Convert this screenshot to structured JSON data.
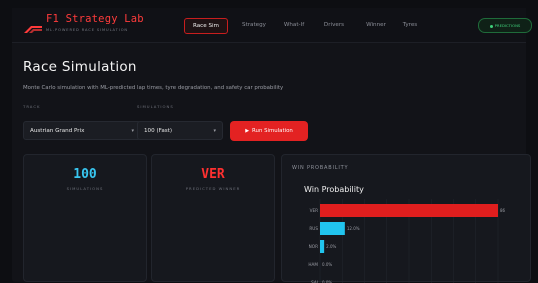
{
  "nav": {
    "brand": "F1 Strategy Lab",
    "brand_sub": "ML-POWERED RACE SIMULATION",
    "tabs": [
      {
        "label": "Race Sim",
        "active": true
      },
      {
        "label": "Strategy",
        "active": false
      },
      {
        "label": "What-If",
        "active": false
      },
      {
        "label": "Drivers",
        "active": false
      },
      {
        "label": "Winner",
        "active": false
      },
      {
        "label": "Tyres",
        "active": false
      }
    ],
    "status": "PREDICTIONS"
  },
  "header": {
    "title": "Race Simulation",
    "subtitle": "Monte Carlo simulation with ML-predicted lap times, tyre degradation, and safety car probability"
  },
  "controls": {
    "track_label": "TRACK",
    "track_value": "Austrian Grand Prix",
    "sims_label": "SIMULATIONS",
    "sims_value": "100 (Fast)",
    "run_label": "Run Simulation"
  },
  "stats": [
    {
      "value": "100",
      "label": "SIMULATIONS",
      "color": "#38c6f0"
    },
    {
      "value": "VER",
      "label": "PREDICTED WINNER",
      "color": "#ff3030"
    }
  ],
  "win_panel": {
    "header": "WIN PROBABILITY"
  },
  "colors": {
    "accent": "#e32222",
    "secondary": "#21c4ee"
  },
  "chart_data": {
    "type": "bar",
    "orientation": "horizontal",
    "title": "Win Probability",
    "categories": [
      "VER",
      "RUS",
      "NOR",
      "HAM",
      "SAI"
    ],
    "values": [
      86,
      12.0,
      2.0,
      0.0,
      0.0
    ],
    "value_labels": [
      "86",
      "12.0%",
      "2.0%",
      "0.0%",
      "0.0%"
    ],
    "bar_colors": [
      "#e01e1e",
      "#21c4ee",
      "#21c4ee",
      "#21c4ee",
      "#21c4ee"
    ],
    "xlim": [
      0,
      86
    ],
    "grid": true
  }
}
